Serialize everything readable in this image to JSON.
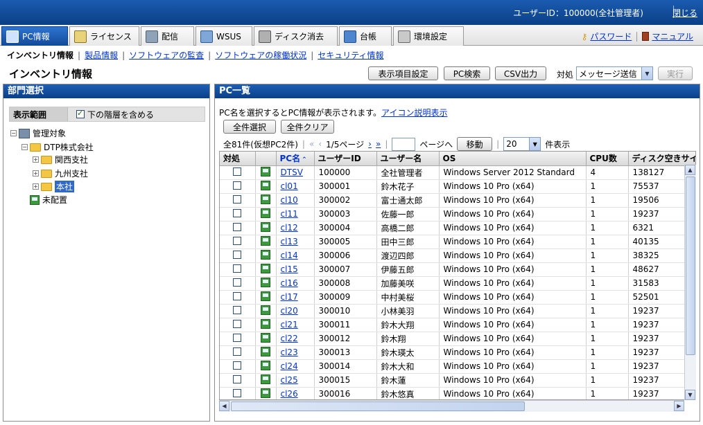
{
  "header": {
    "user_label": "ユーザーID：100000(全社管理者)",
    "close_label": "閉じる"
  },
  "nav": {
    "tabs": [
      {
        "label": "PC情報",
        "icon": "pc-icon",
        "active": true
      },
      {
        "label": "ライセンス",
        "icon": "license-icon",
        "active": false
      },
      {
        "label": "配信",
        "icon": "distribution-icon",
        "active": false
      },
      {
        "label": "WSUS",
        "icon": "wsus-icon",
        "active": false
      },
      {
        "label": "ディスク消去",
        "icon": "disk-erase-icon",
        "active": false
      },
      {
        "label": "台帳",
        "icon": "ledger-icon",
        "active": false
      },
      {
        "label": "環境設定",
        "icon": "tools-icon",
        "active": false
      }
    ],
    "password_label": "パスワード",
    "manual_label": "マニュアル"
  },
  "subnav": {
    "current": "インベントリ情報",
    "links": [
      "製品情報",
      "ソフトウェアの監査",
      "ソフトウェアの稼働状況",
      "セキュリティ情報"
    ]
  },
  "page": {
    "title": "インベントリ情報"
  },
  "toolbar": {
    "display_settings": "表示項目設定",
    "pc_search": "PC検索",
    "csv_output": "CSV出力",
    "action_label": "対処",
    "action_value": "メッセージ送信",
    "execute": "実行"
  },
  "left": {
    "title": "部門選択",
    "range_label": "表示範囲",
    "include_lower": "下の階層を含める",
    "include_lower_checked": true,
    "tree": {
      "root": "管理対象",
      "company": "DTP株式会社",
      "branches": [
        "関西支社",
        "九州支社",
        "本社"
      ],
      "selected": "本社",
      "unassigned": "未配置"
    }
  },
  "right": {
    "title": "PC一覧",
    "hint": "PC名を選択するとPC情報が表示されます。",
    "icon_help": "アイコン説明表示",
    "select_all": "全件選択",
    "clear_all": "全件クリア",
    "count_text": "全81件(仮想PC2件)",
    "page_text": "1/5ページ",
    "page_input": "",
    "page_goto": "ページへ",
    "move": "移動",
    "per_page": "20",
    "per_page_suffix": "件表示",
    "columns": [
      "対処",
      "",
      "PC名",
      "ユーザーID",
      "ユーザー名",
      "OS",
      "CPU数",
      "ディスク空きサイズ"
    ],
    "rows": [
      {
        "pc": "DTSV",
        "uid": "100000",
        "uname": "全社管理者",
        "os": "Windows Server 2012 Standard",
        "cpu": "4",
        "disk": "138127"
      },
      {
        "pc": "cl01",
        "uid": "300001",
        "uname": "鈴木花子",
        "os": "Windows 10 Pro (x64)",
        "cpu": "1",
        "disk": "75537"
      },
      {
        "pc": "cl10",
        "uid": "300002",
        "uname": "富士通太郎",
        "os": "Windows 10 Pro (x64)",
        "cpu": "1",
        "disk": "19506"
      },
      {
        "pc": "cl11",
        "uid": "300003",
        "uname": "佐藤一郎",
        "os": "Windows 10 Pro (x64)",
        "cpu": "1",
        "disk": "19237"
      },
      {
        "pc": "cl12",
        "uid": "300004",
        "uname": "高橋二郎",
        "os": "Windows 10 Pro (x64)",
        "cpu": "1",
        "disk": "6321"
      },
      {
        "pc": "cl13",
        "uid": "300005",
        "uname": "田中三郎",
        "os": "Windows 10 Pro (x64)",
        "cpu": "1",
        "disk": "40135"
      },
      {
        "pc": "cl14",
        "uid": "300006",
        "uname": "渡辺四郎",
        "os": "Windows 10 Pro (x64)",
        "cpu": "1",
        "disk": "38325"
      },
      {
        "pc": "cl15",
        "uid": "300007",
        "uname": "伊藤五郎",
        "os": "Windows 10 Pro (x64)",
        "cpu": "1",
        "disk": "48627"
      },
      {
        "pc": "cl16",
        "uid": "300008",
        "uname": "加藤美咲",
        "os": "Windows 10 Pro (x64)",
        "cpu": "1",
        "disk": "31583"
      },
      {
        "pc": "cl17",
        "uid": "300009",
        "uname": "中村美桜",
        "os": "Windows 10 Pro (x64)",
        "cpu": "1",
        "disk": "52501"
      },
      {
        "pc": "cl20",
        "uid": "300010",
        "uname": "小林美羽",
        "os": "Windows 10 Pro (x64)",
        "cpu": "1",
        "disk": "19237"
      },
      {
        "pc": "cl21",
        "uid": "300011",
        "uname": "鈴木大翔",
        "os": "Windows 10 Pro (x64)",
        "cpu": "1",
        "disk": "19237"
      },
      {
        "pc": "cl22",
        "uid": "300012",
        "uname": "鈴木翔",
        "os": "Windows 10 Pro (x64)",
        "cpu": "1",
        "disk": "19237"
      },
      {
        "pc": "cl23",
        "uid": "300013",
        "uname": "鈴木瑛太",
        "os": "Windows 10 Pro (x64)",
        "cpu": "1",
        "disk": "19237"
      },
      {
        "pc": "cl24",
        "uid": "300014",
        "uname": "鈴木大和",
        "os": "Windows 10 Pro (x64)",
        "cpu": "1",
        "disk": "19237"
      },
      {
        "pc": "cl25",
        "uid": "300015",
        "uname": "鈴木蓮",
        "os": "Windows 10 Pro (x64)",
        "cpu": "1",
        "disk": "19237"
      },
      {
        "pc": "cl26",
        "uid": "300016",
        "uname": "鈴木悠真",
        "os": "Windows 10 Pro (x64)",
        "cpu": "1",
        "disk": "19237"
      }
    ]
  },
  "colors": {
    "header_blue": "#0b3f86",
    "link": "#0033cc",
    "tab_active": "#1e5fb5"
  }
}
